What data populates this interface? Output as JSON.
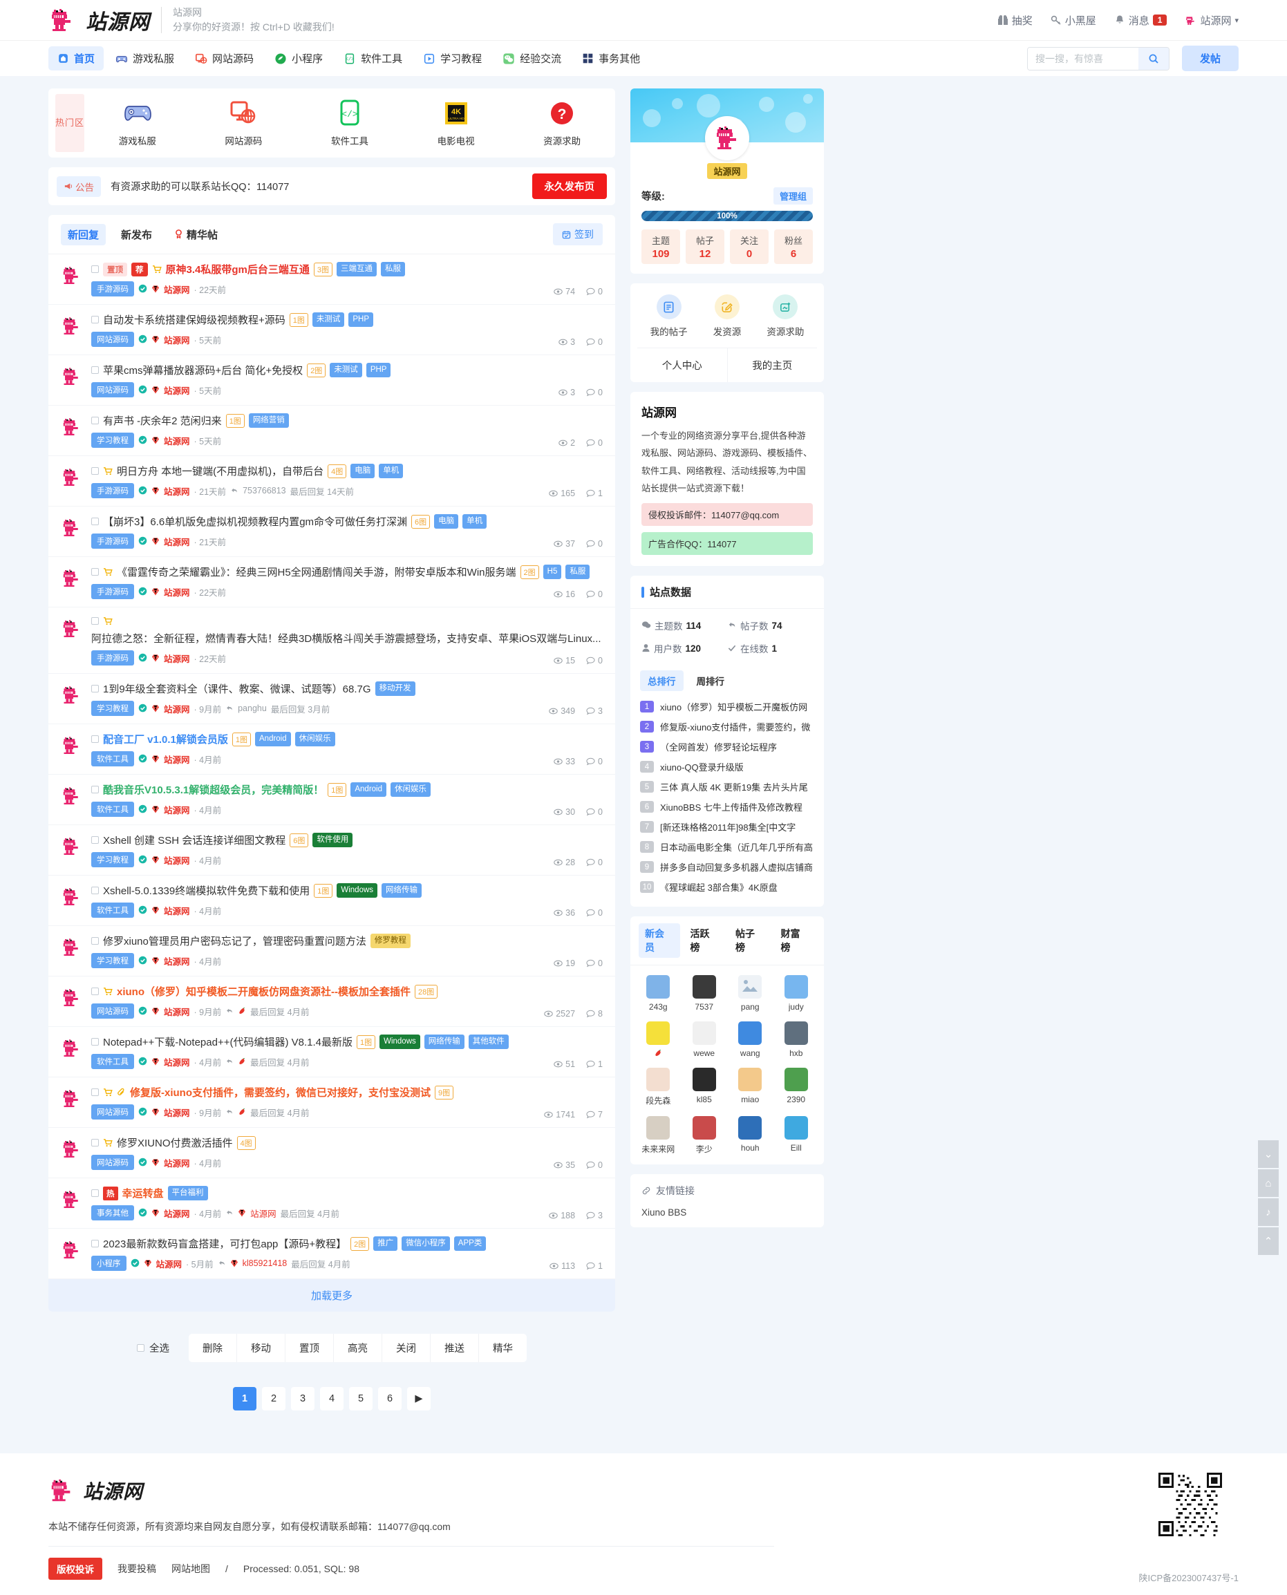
{
  "header": {
    "logo_text": "站源网",
    "slogan_line1": "站源网",
    "slogan_line2": "分享你的好资源！按 Ctrl+D 收藏我们!",
    "right_items": [
      {
        "label": "抽奖",
        "icon": "gift-icon"
      },
      {
        "label": "小黑屋",
        "icon": "key-icon"
      },
      {
        "label": "消息",
        "icon": "bell-icon",
        "badge": "1"
      },
      {
        "label": "站源网",
        "icon": "user-avatar-icon",
        "caret": "▾"
      }
    ]
  },
  "nav": {
    "items": [
      {
        "label": "首页",
        "icon": "home-icon",
        "active": true
      },
      {
        "label": "游戏私服",
        "icon": "gamepad-icon",
        "active": false
      },
      {
        "label": "网站源码",
        "icon": "monitor-globe-icon",
        "active": false
      },
      {
        "label": "小程序",
        "icon": "miniprogram-icon",
        "active": false
      },
      {
        "label": "软件工具",
        "icon": "code-icon",
        "active": false
      },
      {
        "label": "学习教程",
        "icon": "play-icon",
        "active": false
      },
      {
        "label": "经验交流",
        "icon": "wechat-icon",
        "active": false
      },
      {
        "label": "事务其他",
        "icon": "grid-icon",
        "active": false
      }
    ],
    "search_placeholder": "搜一搜，有惊喜",
    "search_value": "",
    "post_button": "发帖"
  },
  "hotzone": {
    "label": "热门区",
    "items": [
      {
        "label": "游戏私服",
        "icon": "gamepad-icon"
      },
      {
        "label": "网站源码",
        "icon": "monitor-globe-icon"
      },
      {
        "label": "软件工具",
        "icon": "code-bracket-icon"
      },
      {
        "label": "电影电视",
        "icon": "4k-ultrahd-icon"
      },
      {
        "label": "资源求助",
        "icon": "question-circle-icon"
      }
    ]
  },
  "notice": {
    "tag": "公告",
    "text": "有资源求助的可以联系站长QQ：114077",
    "button": "永久发布页"
  },
  "list_tabs": {
    "tabs": [
      {
        "label": "新回复",
        "active": true
      },
      {
        "label": "新发布",
        "active": false
      },
      {
        "label": "精华帖",
        "active": false,
        "icon": "medal-icon"
      }
    ],
    "signin": "签到"
  },
  "threads": [
    {
      "title": "原神3.4私服带gm后台三端互通",
      "title_style": "bold-red",
      "pre_tags": [
        {
          "text": "置顶",
          "type": "top"
        },
        {
          "text": "荐",
          "type": "rec"
        }
      ],
      "cart": true,
      "imgcount": "3图",
      "tags": [
        {
          "text": "三端互通",
          "type": "blue"
        },
        {
          "text": "私服",
          "type": "blue"
        }
      ],
      "forum": "手游源码",
      "author": "站源网",
      "time": "22天前",
      "views": "74",
      "replies": "0"
    },
    {
      "title": "自动发卡系统搭建保姆级视频教程+源码",
      "title_style": "",
      "imgcount": "1图",
      "tags": [
        {
          "text": "未测试",
          "type": "blue"
        },
        {
          "text": "PHP",
          "type": "blue"
        }
      ],
      "forum": "网站源码",
      "author": "站源网",
      "time": "5天前",
      "views": "3",
      "replies": "0"
    },
    {
      "title": "苹果cms弹幕播放器源码+后台 简化+免授权",
      "title_style": "",
      "imgcount": "2图",
      "tags": [
        {
          "text": "未测试",
          "type": "blue"
        },
        {
          "text": "PHP",
          "type": "blue"
        }
      ],
      "forum": "网站源码",
      "author": "站源网",
      "time": "5天前",
      "views": "3",
      "replies": "0"
    },
    {
      "title": "有声书 -庆余年2 范闲归来",
      "title_style": "",
      "imgcount": "1图",
      "tags": [
        {
          "text": "网络营销",
          "type": "blue"
        }
      ],
      "forum": "学习教程",
      "author": "站源网",
      "time": "5天前",
      "views": "2",
      "replies": "0"
    },
    {
      "title": "明日方舟 本地一键端(不用虚拟机)，自带后台",
      "title_style": "",
      "cart": true,
      "imgcount": "4图",
      "tags": [
        {
          "text": "电脑",
          "type": "blue"
        },
        {
          "text": "单机",
          "type": "blue"
        }
      ],
      "forum": "手游源码",
      "author": "站源网",
      "time": "21天前",
      "last_replier": "753766813",
      "last_reply": "最后回复 14天前",
      "views": "165",
      "replies": "1"
    },
    {
      "title": "【崩坏3】6.6单机版免虚拟机视频教程内置gm命令可做任务打深渊",
      "title_style": "",
      "imgcount": "6图",
      "tags": [
        {
          "text": "电脑",
          "type": "blue"
        },
        {
          "text": "单机",
          "type": "blue"
        }
      ],
      "forum": "手游源码",
      "author": "站源网",
      "time": "21天前",
      "views": "37",
      "replies": "0"
    },
    {
      "title": "《雷霆传奇之荣耀霸业》：经典三网H5全网通剧情闯关手游，附带安卓版本和Win服务端",
      "title_style": "",
      "cart": true,
      "imgcount": "2图",
      "tags": [
        {
          "text": "H5",
          "type": "blue"
        },
        {
          "text": "私服",
          "type": "blue"
        }
      ],
      "forum": "手游源码",
      "author": "站源网",
      "time": "22天前",
      "views": "16",
      "replies": "0"
    },
    {
      "title": "阿拉德之怒：全新征程，燃情青春大陆！经典3D横版格斗闯关手游震撼登场，支持安卓、苹果iOS双端与Linux...",
      "title_style": "",
      "cart": true,
      "imgcount": "",
      "tags": [],
      "forum": "手游源码",
      "author": "站源网",
      "time": "22天前",
      "views": "15",
      "replies": "0"
    },
    {
      "title": "1到9年级全套资料全（课件、教案、微课、试题等）68.7G",
      "title_style": "",
      "imgcount": "",
      "tags": [
        {
          "text": "移动开发",
          "type": "blue"
        }
      ],
      "forum": "学习教程",
      "author": "站源网",
      "time": "9月前",
      "last_replier": "panghu",
      "last_reply": "最后回复 3月前",
      "views": "349",
      "replies": "3"
    },
    {
      "title": "配音工厂 v1.0.1解锁会员版",
      "title_style": "bold-blue",
      "imgcount": "1图",
      "tags": [
        {
          "text": "Android",
          "type": "blue"
        },
        {
          "text": "休闲娱乐",
          "type": "blue"
        }
      ],
      "forum": "软件工具",
      "author": "站源网",
      "time": "4月前",
      "views": "33",
      "replies": "0"
    },
    {
      "title": "酷我音乐V10.5.3.1解锁超级会员，完美精简版！",
      "title_style": "bold-green",
      "imgcount": "1图",
      "tags": [
        {
          "text": "Android",
          "type": "blue"
        },
        {
          "text": "休闲娱乐",
          "type": "blue"
        }
      ],
      "forum": "软件工具",
      "author": "站源网",
      "time": "4月前",
      "views": "30",
      "replies": "0"
    },
    {
      "title": "Xshell 创建 SSH 会话连接详细图文教程",
      "title_style": "",
      "imgcount": "6图",
      "tags": [
        {
          "text": "软件使用",
          "type": "green"
        }
      ],
      "forum": "学习教程",
      "author": "站源网",
      "time": "4月前",
      "views": "28",
      "replies": "0"
    },
    {
      "title": "Xshell-5.0.1339终端模拟软件免费下载和使用",
      "title_style": "",
      "imgcount": "1图",
      "tags": [
        {
          "text": "Windows",
          "type": "green"
        },
        {
          "text": "网络传输",
          "type": "blue"
        }
      ],
      "forum": "软件工具",
      "author": "站源网",
      "time": "4月前",
      "views": "36",
      "replies": "0"
    },
    {
      "title": "修罗xiuno管理员用户密码忘记了，管理密码重置问题方法",
      "title_style": "",
      "imgcount": "",
      "tags": [
        {
          "text": "修罗教程",
          "type": "yellow"
        }
      ],
      "forum": "学习教程",
      "author": "站源网",
      "time": "4月前",
      "views": "19",
      "replies": "0"
    },
    {
      "title": "xiuno（修罗）知乎模板二开魔板仿网盘资源社--模板加全套插件",
      "title_style": "bold-orange",
      "cart": true,
      "imgcount": "28图",
      "tags": [],
      "forum": "网站源码",
      "author": "站源网",
      "time": "9月前",
      "hot_reply": true,
      "last_reply": "最后回复 4月前",
      "views": "2527",
      "replies": "8"
    },
    {
      "title": "Notepad++下载-Notepad++(代码编辑器) V8.1.4最新版",
      "title_style": "",
      "imgcount": "1图",
      "tags": [
        {
          "text": "Windows",
          "type": "green"
        },
        {
          "text": "网络传输",
          "type": "blue"
        },
        {
          "text": "其他软件",
          "type": "blue"
        }
      ],
      "forum": "软件工具",
      "author": "站源网",
      "time": "4月前",
      "hot_reply": true,
      "last_reply": "最后回复 4月前",
      "views": "51",
      "replies": "1"
    },
    {
      "title": "修复版-xiuno支付插件，需要签约，微信已对接好，支付宝没测试",
      "title_style": "bold-orange",
      "cart": true,
      "clip": true,
      "imgcount": "9图",
      "tags": [],
      "forum": "网站源码",
      "author": "站源网",
      "time": "9月前",
      "hot_reply": true,
      "last_reply": "最后回复 4月前",
      "views": "1741",
      "replies": "7"
    },
    {
      "title": "修罗XIUNO付费激活插件",
      "title_style": "",
      "cart": true,
      "imgcount": "4图",
      "tags": [],
      "forum": "网站源码",
      "author": "站源网",
      "time": "4月前",
      "views": "35",
      "replies": "0"
    },
    {
      "title": "幸运转盘",
      "title_style": "bold-orange",
      "pre_tags": [
        {
          "text": "热",
          "type": "hot"
        }
      ],
      "imgcount": "",
      "tags": [
        {
          "text": "平台福利",
          "type": "blue"
        }
      ],
      "forum": "事务其他",
      "author": "站源网",
      "time": "4月前",
      "last_replier": "站源网",
      "last_reply": "最后回复 4月前",
      "views": "188",
      "replies": "3"
    },
    {
      "title": "2023最新款数码盲盒搭建，可打包app【源码+教程】",
      "title_style": "",
      "imgcount": "2图",
      "tags": [
        {
          "text": "推广",
          "type": "blue"
        },
        {
          "text": "微信小程序",
          "type": "blue"
        },
        {
          "text": "APP类",
          "type": "blue"
        }
      ],
      "forum": "小程序",
      "author": "站源网",
      "time": "5月前",
      "last_replier": "kl85921418",
      "last_reply": "最后回复 4月前",
      "views": "113",
      "replies": "1"
    }
  ],
  "load_more": "加载更多",
  "bulk": {
    "select_all": "全选",
    "buttons": [
      "删除",
      "移动",
      "置顶",
      "高亮",
      "关闭",
      "推送",
      "精华"
    ]
  },
  "pagination": {
    "pages": [
      "1",
      "2",
      "3",
      "4",
      "5",
      "6"
    ],
    "active": "1",
    "next": "▶"
  },
  "profile": {
    "username": "站源网",
    "level_label": "等级:",
    "group": "管理组",
    "progress": "100%",
    "stats": [
      {
        "key": "主题",
        "value": "109"
      },
      {
        "key": "帖子",
        "value": "12"
      },
      {
        "key": "关注",
        "value": "0"
      },
      {
        "key": "粉丝",
        "value": "6"
      }
    ]
  },
  "quick": {
    "items": [
      {
        "label": "我的帖子",
        "icon": "document-icon"
      },
      {
        "label": "发资源",
        "icon": "edit-icon"
      },
      {
        "label": "资源求助",
        "icon": "add-image-icon"
      }
    ],
    "bottom": [
      "个人中心",
      "我的主页"
    ]
  },
  "about": {
    "title": "站源网",
    "text": "一个专业的网络资源分享平台,提供各种游戏私服、网站源码、游戏源码、模板插件、软件工具、网络教程、活动线报等,为中国站长提供一站式资源下载！",
    "complaint": "侵权投诉邮件：114077@qq.com",
    "ad": "广告合作QQ：114077"
  },
  "site_stats": {
    "title": "站点数据",
    "items": [
      {
        "icon": "comment-icon",
        "label": "主题数",
        "value": "114"
      },
      {
        "icon": "reply-icon",
        "label": "帖子数",
        "value": "74"
      },
      {
        "icon": "user-icon",
        "label": "用户数",
        "value": "120"
      },
      {
        "icon": "check-icon",
        "label": "在线数",
        "value": "1"
      }
    ]
  },
  "ranking": {
    "tabs": [
      {
        "label": "总排行",
        "active": true
      },
      {
        "label": "周排行",
        "active": false
      }
    ],
    "items": [
      {
        "no": "1",
        "text": "xiuno（修罗）知乎模板二开魔板仿网"
      },
      {
        "no": "2",
        "text": "修复版-xiuno支付插件，需要签约，微"
      },
      {
        "no": "3",
        "text": "（全网首发）修罗轻论坛程序"
      },
      {
        "no": "4",
        "text": "xiuno-QQ登录升级版"
      },
      {
        "no": "5",
        "text": "三体 真人版 4K 更新19集 去片头片尾"
      },
      {
        "no": "6",
        "text": "XiunoBBS 七牛上传插件及修改教程"
      },
      {
        "no": "7",
        "text": "[新还珠格格2011年]98集全[中文字"
      },
      {
        "no": "8",
        "text": "日本动画电影全集（近几年几乎所有高"
      },
      {
        "no": "9",
        "text": "拼多多自动回复多多机器人虚拟店铺商"
      },
      {
        "no": "10",
        "text": "《猩球崛起 3部合集》4K原盘"
      }
    ]
  },
  "members": {
    "tabs": [
      {
        "label": "新会员",
        "active": true
      },
      {
        "label": "活跃榜",
        "active": false
      },
      {
        "label": "帖子榜",
        "active": false
      },
      {
        "label": "财富榜",
        "active": false
      }
    ],
    "list": [
      {
        "name": "243g",
        "color": "#7fb3e8"
      },
      {
        "name": "7537",
        "color": "#3a3a3a"
      },
      {
        "name": "pang",
        "color": "#dfe6ee",
        "broken": true,
        "prefix": "pang"
      },
      {
        "name": "judy",
        "color": "#77b6ef"
      },
      {
        "name": "",
        "color": "#f5e03a",
        "suffix_icon": "hot-icon"
      },
      {
        "name": "wewe",
        "color": "#f0f0f0"
      },
      {
        "name": "wang",
        "color": "#3f8ae0"
      },
      {
        "name": "hxb",
        "color": "#5f6f7e"
      },
      {
        "name": "段先森",
        "color": "#f3ded0"
      },
      {
        "name": "kl85",
        "color": "#2a2a2a"
      },
      {
        "name": "miao",
        "color": "#f3c98b"
      },
      {
        "name": "2390",
        "color": "#4e9f4e"
      },
      {
        "name": "未来来网",
        "color": "#d7cfc3"
      },
      {
        "name": "李少",
        "color": "#c94b4b"
      },
      {
        "name": "houh",
        "color": "#2e6fb8"
      },
      {
        "name": "Eill",
        "color": "#3fa9e0"
      }
    ]
  },
  "friend": {
    "title": "友情链接",
    "links": [
      "Xiuno BBS"
    ]
  },
  "footer": {
    "logo_text": "站源网",
    "note": "本站不储存任何资源，所有资源均来自网友自愿分享，如有侵权请联系邮箱：114077@qq.com",
    "copyright_badge": "版权投诉",
    "links": [
      "我要投稿",
      "网站地图",
      "/"
    ],
    "processed": "Processed: 0.051, SQL: 98",
    "icp": "陕ICP备2023007437号-1"
  },
  "rail": [
    {
      "icon": "chevron-down-icon"
    },
    {
      "icon": "home-icon"
    },
    {
      "icon": "bell-icon"
    },
    {
      "icon": "chevron-up-icon"
    }
  ]
}
